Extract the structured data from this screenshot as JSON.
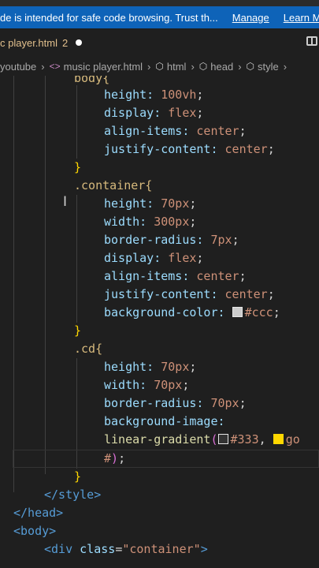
{
  "banner": {
    "message": "de is intended for safe code browsing. Trust th...",
    "manage": "Manage",
    "learn_more": "Learn More"
  },
  "tab": {
    "name": "c player.html",
    "num": "2"
  },
  "breadcrumb": {
    "items": [
      "youtube",
      "music player.html",
      "html",
      "head",
      "style"
    ]
  },
  "code": {
    "body_sel": "body{",
    "height": "height:",
    "height_val": "100vh",
    "display": "display:",
    "display_val": "flex",
    "align": "align-items:",
    "align_val": "center",
    "justify": "justify-content:",
    "justify_val": "center",
    "close": "}",
    "container_sel": ".container{",
    "c_height_val": "70px",
    "width": "width:",
    "c_width_val": "300px",
    "radius": "border-radius:",
    "c_radius_val": "7px",
    "bgcolor": "background-color:",
    "bgcolor_val": "#ccc",
    "cd_sel": ".cd{",
    "cd_height_val": "70px",
    "cd_width_val": "70px",
    "cd_radius_val": "70px",
    "bgimage": "background-image:",
    "gradient_fn": "linear-gradient",
    "gradient_val1": "#333",
    "gradient_val2": "go",
    "hash": "#",
    "end_style": "</style>",
    "end_head": "</head>",
    "body_open": "<body>",
    "div_tag": "<div",
    "div_attr": "class",
    "div_val": "\"container\"",
    "div_close": ">"
  },
  "colors": {
    "banner_bg": "#0e63b8",
    "editor_bg": "#1f1f1f",
    "swatch_ccc": "#cccccc",
    "swatch_333": "#333333",
    "swatch_gold": "#ffd700"
  }
}
